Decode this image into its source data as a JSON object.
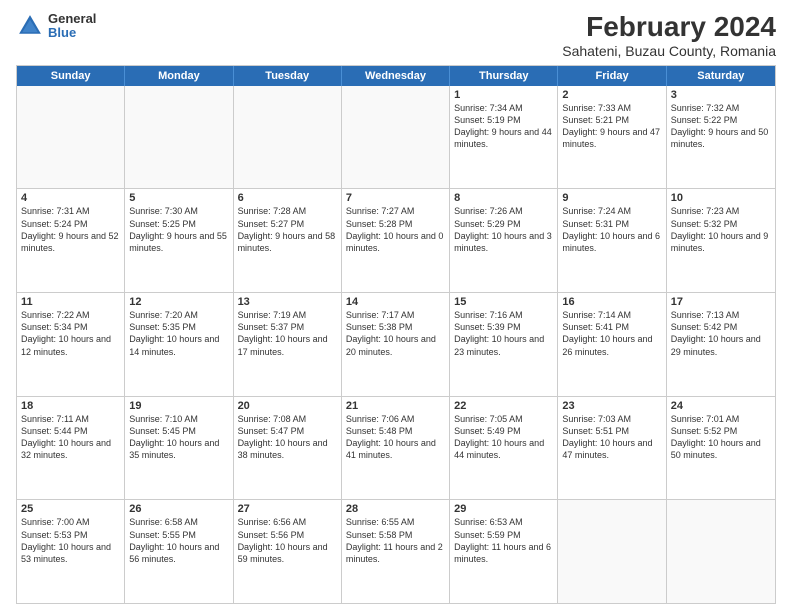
{
  "logo": {
    "general": "General",
    "blue": "Blue"
  },
  "title": "February 2024",
  "subtitle": "Sahateni, Buzau County, Romania",
  "days_of_week": [
    "Sunday",
    "Monday",
    "Tuesday",
    "Wednesday",
    "Thursday",
    "Friday",
    "Saturday"
  ],
  "weeks": [
    [
      {
        "day": "",
        "empty": true
      },
      {
        "day": "",
        "empty": true
      },
      {
        "day": "",
        "empty": true
      },
      {
        "day": "",
        "empty": true
      },
      {
        "day": "1",
        "sunrise": "7:34 AM",
        "sunset": "5:19 PM",
        "daylight": "9 hours and 44 minutes."
      },
      {
        "day": "2",
        "sunrise": "7:33 AM",
        "sunset": "5:21 PM",
        "daylight": "9 hours and 47 minutes."
      },
      {
        "day": "3",
        "sunrise": "7:32 AM",
        "sunset": "5:22 PM",
        "daylight": "9 hours and 50 minutes."
      }
    ],
    [
      {
        "day": "4",
        "sunrise": "7:31 AM",
        "sunset": "5:24 PM",
        "daylight": "9 hours and 52 minutes."
      },
      {
        "day": "5",
        "sunrise": "7:30 AM",
        "sunset": "5:25 PM",
        "daylight": "9 hours and 55 minutes."
      },
      {
        "day": "6",
        "sunrise": "7:28 AM",
        "sunset": "5:27 PM",
        "daylight": "9 hours and 58 minutes."
      },
      {
        "day": "7",
        "sunrise": "7:27 AM",
        "sunset": "5:28 PM",
        "daylight": "10 hours and 0 minutes."
      },
      {
        "day": "8",
        "sunrise": "7:26 AM",
        "sunset": "5:29 PM",
        "daylight": "10 hours and 3 minutes."
      },
      {
        "day": "9",
        "sunrise": "7:24 AM",
        "sunset": "5:31 PM",
        "daylight": "10 hours and 6 minutes."
      },
      {
        "day": "10",
        "sunrise": "7:23 AM",
        "sunset": "5:32 PM",
        "daylight": "10 hours and 9 minutes."
      }
    ],
    [
      {
        "day": "11",
        "sunrise": "7:22 AM",
        "sunset": "5:34 PM",
        "daylight": "10 hours and 12 minutes."
      },
      {
        "day": "12",
        "sunrise": "7:20 AM",
        "sunset": "5:35 PM",
        "daylight": "10 hours and 14 minutes."
      },
      {
        "day": "13",
        "sunrise": "7:19 AM",
        "sunset": "5:37 PM",
        "daylight": "10 hours and 17 minutes."
      },
      {
        "day": "14",
        "sunrise": "7:17 AM",
        "sunset": "5:38 PM",
        "daylight": "10 hours and 20 minutes."
      },
      {
        "day": "15",
        "sunrise": "7:16 AM",
        "sunset": "5:39 PM",
        "daylight": "10 hours and 23 minutes."
      },
      {
        "day": "16",
        "sunrise": "7:14 AM",
        "sunset": "5:41 PM",
        "daylight": "10 hours and 26 minutes."
      },
      {
        "day": "17",
        "sunrise": "7:13 AM",
        "sunset": "5:42 PM",
        "daylight": "10 hours and 29 minutes."
      }
    ],
    [
      {
        "day": "18",
        "sunrise": "7:11 AM",
        "sunset": "5:44 PM",
        "daylight": "10 hours and 32 minutes."
      },
      {
        "day": "19",
        "sunrise": "7:10 AM",
        "sunset": "5:45 PM",
        "daylight": "10 hours and 35 minutes."
      },
      {
        "day": "20",
        "sunrise": "7:08 AM",
        "sunset": "5:47 PM",
        "daylight": "10 hours and 38 minutes."
      },
      {
        "day": "21",
        "sunrise": "7:06 AM",
        "sunset": "5:48 PM",
        "daylight": "10 hours and 41 minutes."
      },
      {
        "day": "22",
        "sunrise": "7:05 AM",
        "sunset": "5:49 PM",
        "daylight": "10 hours and 44 minutes."
      },
      {
        "day": "23",
        "sunrise": "7:03 AM",
        "sunset": "5:51 PM",
        "daylight": "10 hours and 47 minutes."
      },
      {
        "day": "24",
        "sunrise": "7:01 AM",
        "sunset": "5:52 PM",
        "daylight": "10 hours and 50 minutes."
      }
    ],
    [
      {
        "day": "25",
        "sunrise": "7:00 AM",
        "sunset": "5:53 PM",
        "daylight": "10 hours and 53 minutes."
      },
      {
        "day": "26",
        "sunrise": "6:58 AM",
        "sunset": "5:55 PM",
        "daylight": "10 hours and 56 minutes."
      },
      {
        "day": "27",
        "sunrise": "6:56 AM",
        "sunset": "5:56 PM",
        "daylight": "10 hours and 59 minutes."
      },
      {
        "day": "28",
        "sunrise": "6:55 AM",
        "sunset": "5:58 PM",
        "daylight": "11 hours and 2 minutes."
      },
      {
        "day": "29",
        "sunrise": "6:53 AM",
        "sunset": "5:59 PM",
        "daylight": "11 hours and 6 minutes."
      },
      {
        "day": "",
        "empty": true
      },
      {
        "day": "",
        "empty": true
      }
    ]
  ]
}
